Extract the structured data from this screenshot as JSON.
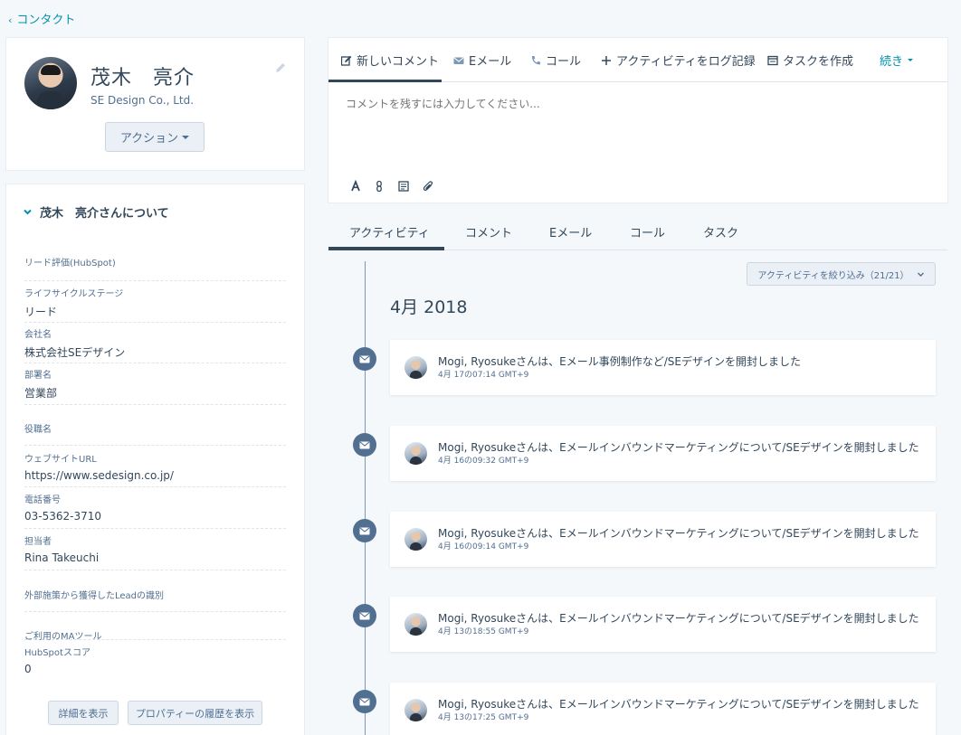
{
  "back_link": "コンタクト",
  "profile": {
    "name": "茂木　亮介",
    "company": "SE Design Co., Ltd.",
    "actions_label": "アクション"
  },
  "about": {
    "header": "茂木　亮介さんについて",
    "properties": [
      {
        "label": "リード評価(HubSpot)",
        "value": ""
      },
      {
        "label": "ライフサイクルステージ",
        "value": "リード"
      },
      {
        "label": "会社名",
        "value": "株式会社SEデザイン"
      },
      {
        "label": "部署名",
        "value": "営業部"
      },
      {
        "label": "役職名",
        "value": ""
      },
      {
        "label": "ウェブサイトURL",
        "value": "https://www.sedesign.co.jp/"
      },
      {
        "label": "電話番号",
        "value": "03-5362-3710"
      },
      {
        "label": "担当者",
        "value": "Rina Takeuchi"
      },
      {
        "label": "外部施策から獲得したLeadの識別",
        "value": ""
      },
      {
        "label": "ご利用のMAツール",
        "value": ""
      },
      {
        "label": "HubSpotスコア",
        "value": "0"
      }
    ],
    "view_details": "詳細を表示",
    "property_history": "プロパティーの履歴を表示"
  },
  "composer": {
    "tabs": [
      "新しいコメント",
      "Eメール",
      "コール",
      "アクティビティをログ記録",
      "タスクを作成",
      "続き"
    ],
    "placeholder": "コメントを残すには入力してください..."
  },
  "timeline": {
    "tabs": [
      "アクティビティ",
      "コメント",
      "Eメール",
      "コール",
      "タスク"
    ],
    "filter_label": "アクティビティを絞り込み（21/21）",
    "month": "4月 2018",
    "events": [
      {
        "text": "Mogi, Ryosukeさんは、Eメール事例制作など/SEデザインを開封しました",
        "time": "4月 17の07:14 GMT+9"
      },
      {
        "text": "Mogi, Ryosukeさんは、Eメールインバウンドマーケティングについて/SEデザインを開封しました",
        "time": "4月 16の09:32 GMT+9"
      },
      {
        "text": "Mogi, Ryosukeさんは、Eメールインバウンドマーケティングについて/SEデザインを開封しました",
        "time": "4月 16の09:14 GMT+9"
      },
      {
        "text": "Mogi, Ryosukeさんは、Eメールインバウンドマーケティングについて/SEデザインを開封しました",
        "time": "4月 13の18:55 GMT+9"
      },
      {
        "text": "Mogi, Ryosukeさんは、Eメールインバウンドマーケティングについて/SEデザインを開封しました",
        "time": "4月 13の17:25 GMT+9"
      }
    ]
  },
  "colors": {
    "accent": "#0091ae",
    "text": "#33475b",
    "muted": "#516f90",
    "button_bg": "#eaf0f6",
    "border": "#cbd6e2",
    "timeline_icon": "#516f90"
  },
  "icons": {
    "composer": [
      "edit-icon",
      "envelope-icon",
      "phone-icon",
      "plus-icon",
      "task-icon"
    ],
    "formatting": [
      "text-format-icon",
      "link-icon",
      "snippet-icon",
      "attachment-icon"
    ],
    "timeline_event": "envelope-icon"
  }
}
